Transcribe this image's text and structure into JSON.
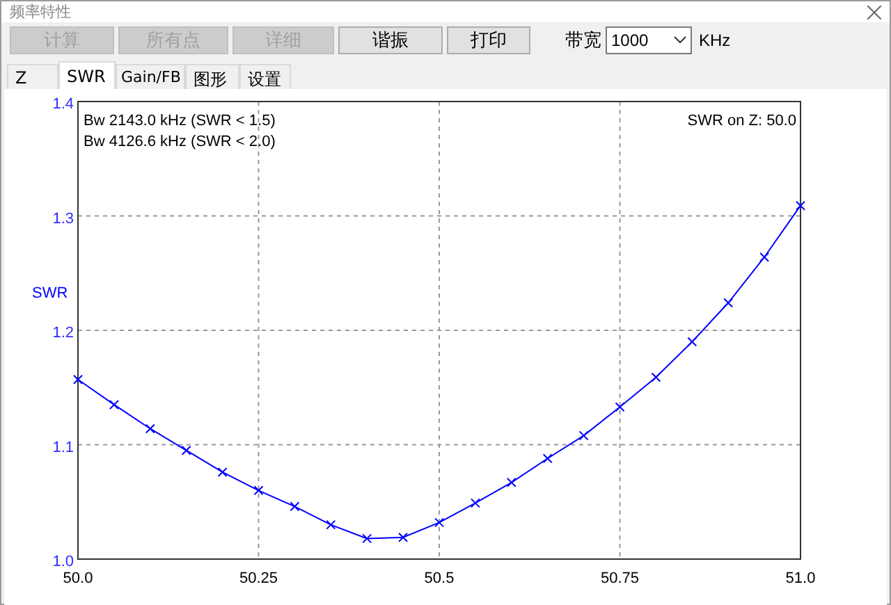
{
  "window": {
    "title": "频率特性"
  },
  "toolbar": {
    "buttons": [
      {
        "label": "计算",
        "disabled": true
      },
      {
        "label": "所有点",
        "disabled": true
      },
      {
        "label": "详细",
        "disabled": true
      },
      {
        "label": "谐振",
        "disabled": false
      },
      {
        "label": "打印",
        "disabled": false
      }
    ],
    "bandwidth": {
      "label": "带宽",
      "value": "1000",
      "unit": "KHz"
    }
  },
  "tabs": [
    {
      "label": "Z",
      "selected": false
    },
    {
      "label": "SWR",
      "selected": true
    },
    {
      "label": "Gain/FB",
      "selected": false
    },
    {
      "label": "图形",
      "selected": false
    },
    {
      "label": "设置",
      "selected": false
    }
  ],
  "chart": {
    "notes": [
      "Bw 2143.0 kHz (SWR < 1.5)",
      "Bw 4126.6 kHz (SWR < 2.0)"
    ],
    "reference": "SWR on Z: 50.0",
    "chart_data": {
      "type": "line",
      "ylabel": "SWR",
      "x": [
        50.0,
        50.05,
        50.1,
        50.15,
        50.2,
        50.25,
        50.3,
        50.35,
        50.4,
        50.45,
        50.5,
        50.55,
        50.6,
        50.65,
        50.7,
        50.75,
        50.8,
        50.85,
        50.9,
        50.95,
        51.0
      ],
      "grid": true,
      "series": [
        {
          "color": "#0000ff",
          "marker": "x",
          "values": [
            1.157,
            1.135,
            1.114,
            1.095,
            1.076,
            1.06,
            1.046,
            1.03,
            1.018,
            1.019,
            1.032,
            1.049,
            1.067,
            1.088,
            1.108,
            1.133,
            1.159,
            1.19,
            1.224,
            1.264,
            1.309
          ]
        }
      ],
      "xlim": [
        50,
        51
      ],
      "ylim": [
        1,
        1.4
      ],
      "xticks": [
        {
          "value": 50,
          "label": "50.0"
        },
        {
          "value": 50.25,
          "label": "50.25"
        },
        {
          "value": 50.5,
          "label": "50.5"
        },
        {
          "value": 50.75,
          "label": "50.75"
        },
        {
          "value": 51,
          "label": "51.0"
        }
      ],
      "yticks": [
        {
          "value": 1,
          "label": "1.0"
        },
        {
          "value": 1.1,
          "label": "1.1"
        },
        {
          "value": 1.2,
          "label": "1.2"
        },
        {
          "value": 1.3,
          "label": "1.3"
        },
        {
          "value": 1.4,
          "label": "1.4"
        }
      ]
    }
  }
}
